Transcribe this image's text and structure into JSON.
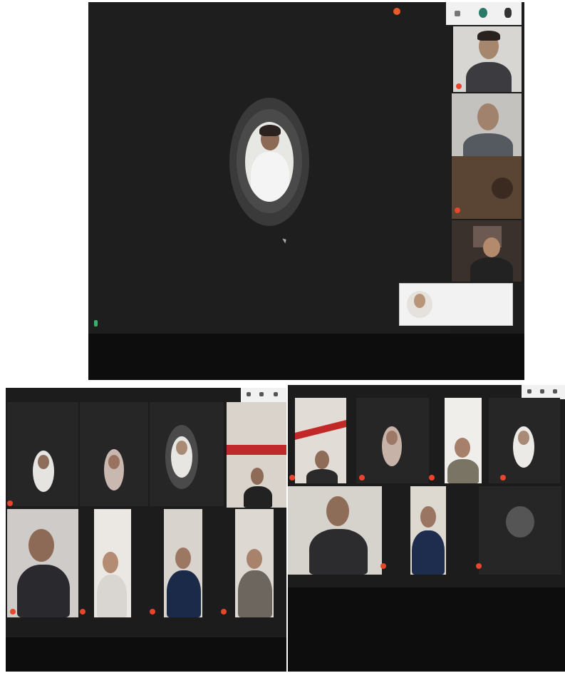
{
  "screens": [
    {
      "id": "top-meeting",
      "self_label": "",
      "recording_label": "",
      "notification_text": "",
      "participants": [
        "",
        "",
        "",
        ""
      ]
    },
    {
      "id": "bottom-left-meeting",
      "participants": [
        "",
        "",
        "",
        "",
        "",
        "",
        "",
        ""
      ]
    },
    {
      "id": "bottom-right-meeting",
      "participants": [
        "",
        "",
        "",
        "",
        "",
        "",
        ""
      ]
    }
  ],
  "colors": {
    "meeting_background": "#1c1c1c",
    "mic_muted": "#e8452c",
    "toolbar": "#f1f1f1"
  },
  "icons": [
    "microphone-muted-icon",
    "pin-icon",
    "record-icon",
    "more-options-icon"
  ]
}
